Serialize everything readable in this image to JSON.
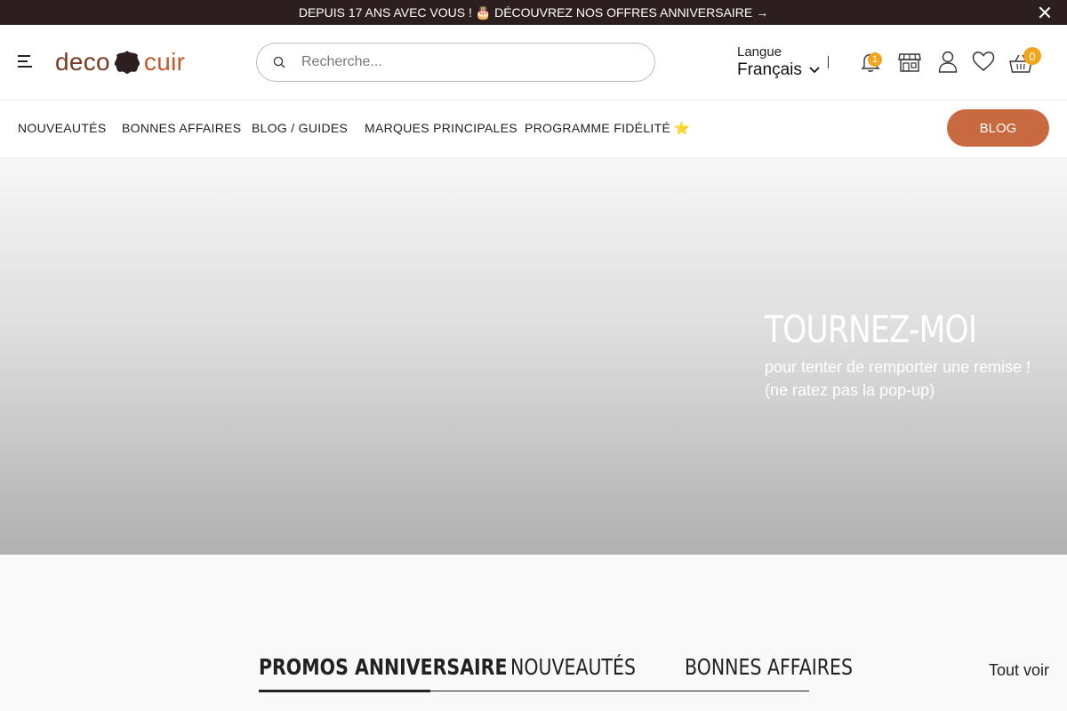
{
  "announcement": {
    "text": "DEPUIS 17 ANS AVEC VOUS ! 🎂 DÉCOUVREZ NOS OFFRES ANNIVERSAIRE →"
  },
  "header": {
    "logo_part1": "deco",
    "logo_part2": "cuir",
    "search_placeholder": "Recherche...",
    "language_label": "Langue",
    "language_value": "Français",
    "notifications_count": "1",
    "cart_count": "0"
  },
  "nav": {
    "items": [
      "NOUVEAUTÉS",
      "BONNES AFFAIRES",
      "BLOG / GUIDES",
      "MARQUES PRINCIPALES",
      "PROGRAMME FIDÉLITÉ ⭐"
    ],
    "blog_button": "BLOG"
  },
  "hero": {
    "title": "TOURNEZ-MOI",
    "line1": "pour tenter de remporter une remise !",
    "line2": "(ne ratez pas la pop-up)"
  },
  "tabs": {
    "items": [
      "PROMOS ANNIVERSAIRE",
      "NOUVEAUTÉS",
      "BONNES AFFAIRES"
    ],
    "active_index": 0,
    "see_all": "Tout voir"
  },
  "colors": {
    "topbar_bg": "#2d1f1f",
    "accent": "#c9693f",
    "badge": "#f2a51a",
    "logo_brown": "#7a3b1e"
  },
  "icons": [
    "close-icon",
    "menu-icon",
    "leather-hide-icon",
    "search-icon",
    "chevron-down-icon",
    "bell-icon",
    "store-icon",
    "user-icon",
    "heart-icon",
    "basket-icon"
  ]
}
